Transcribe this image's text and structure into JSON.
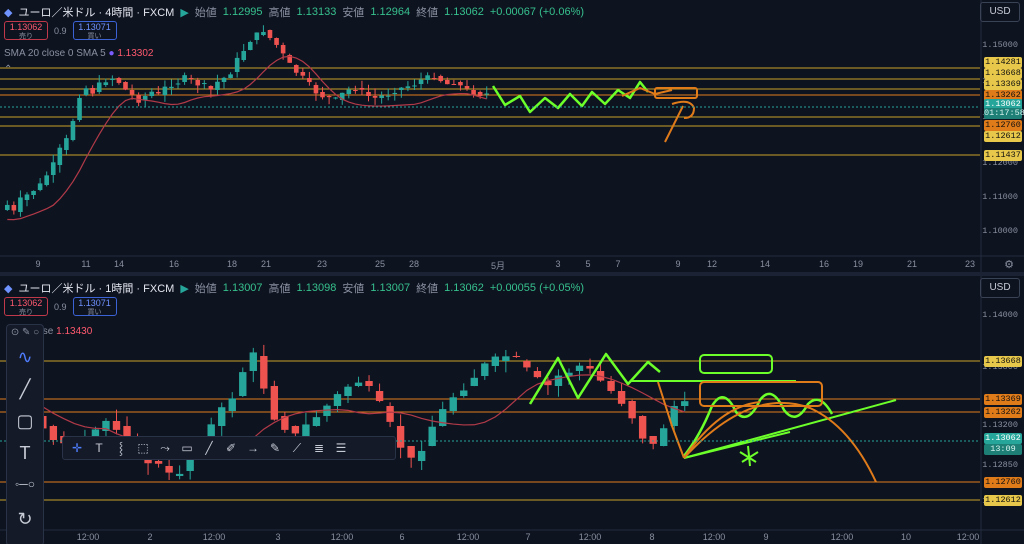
{
  "top": {
    "symbol": "ユーロ／米ドル · 4時間 · FXCM",
    "ohlc": {
      "open_label": "始値",
      "open": "1.12995",
      "high_label": "高値",
      "high": "1.13133",
      "low_label": "安値",
      "low": "1.12964",
      "close_label": "終値",
      "close": "1.13062",
      "change": "+0.00067 (+0.06%)"
    },
    "sell_price": "1.13062",
    "sell_label": "売り",
    "spread": "0.9",
    "buy_price": "1.13071",
    "buy_label": "買い",
    "indicator": "SMA 20 close 0 SMA 5",
    "indicator_value": "1.13302",
    "currency": "USD",
    "y_ticks": [
      "1.15000",
      "1.14000",
      "1.13000",
      "1.12000",
      "1.11000",
      "1.10000",
      "1.09000"
    ],
    "price_labels": [
      {
        "text": "1.14281",
        "kind": "yellow"
      },
      {
        "text": "1.13668",
        "kind": "yellow"
      },
      {
        "text": "1.13369",
        "kind": "yellow"
      },
      {
        "text": "1.13262",
        "kind": "orange"
      },
      {
        "text": "1.13062",
        "kind": "current"
      },
      {
        "text": "01:17:58",
        "kind": "timer"
      },
      {
        "text": "1.12760",
        "kind": "orange"
      },
      {
        "text": "1.12612",
        "kind": "yellow"
      },
      {
        "text": "1.11437",
        "kind": "yellow"
      }
    ],
    "x_labels": [
      "9",
      "11",
      "14",
      "16",
      "18",
      "21",
      "23",
      "25",
      "28",
      "5月",
      "3",
      "5",
      "7",
      "9",
      "12",
      "14",
      "16",
      "19",
      "21",
      "23"
    ]
  },
  "bottom": {
    "symbol": "ユーロ／米ドル · 1時間 · FXCM",
    "ohlc": {
      "open_label": "始値",
      "open": "1.13007",
      "high_label": "高値",
      "high": "1.13098",
      "low_label": "安値",
      "low": "1.13007",
      "close_label": "終値",
      "close": "1.13062",
      "change": "+0.00055 (+0.05%)"
    },
    "sell_price": "1.13062",
    "sell_label": "売り",
    "spread": "0.9",
    "buy_price": "1.13071",
    "buy_label": "買い",
    "indicator": "close",
    "indicator_value": "1.13430",
    "currency": "USD",
    "y_ticks": [
      "1.14000",
      "1.13800",
      "1.13200",
      "1.12850",
      "1.12390"
    ],
    "price_labels": [
      {
        "text": "1.13668",
        "kind": "yellow"
      },
      {
        "text": "1.13369",
        "kind": "orange"
      },
      {
        "text": "1.13262",
        "kind": "orange"
      },
      {
        "text": "1.13062",
        "kind": "current"
      },
      {
        "text": "13:09",
        "kind": "timer"
      },
      {
        "text": "1.12760",
        "kind": "orange"
      },
      {
        "text": "1.12612",
        "kind": "yellow"
      }
    ],
    "x_labels": [
      "12:00",
      "2",
      "12:00",
      "3",
      "12:00",
      "6",
      "12:00",
      "7",
      "12:00",
      "8",
      "12:00",
      "9",
      "12:00",
      "10",
      "12:00"
    ]
  },
  "colors": {
    "bull": "#26a69a",
    "bear": "#ef5350",
    "yellow_line": "#c9a227",
    "orange_line": "#e07b1a",
    "green_draw": "#6cff2a",
    "sma": "#b23a48",
    "current": "#26a69a"
  },
  "icons": [
    "crosshair-icon",
    "text-icon",
    "line-icon",
    "rectangle-icon",
    "path-icon",
    "note-icon",
    "brush-icon",
    "arrow-icon",
    "gear-icon",
    "scissors-icon"
  ]
}
